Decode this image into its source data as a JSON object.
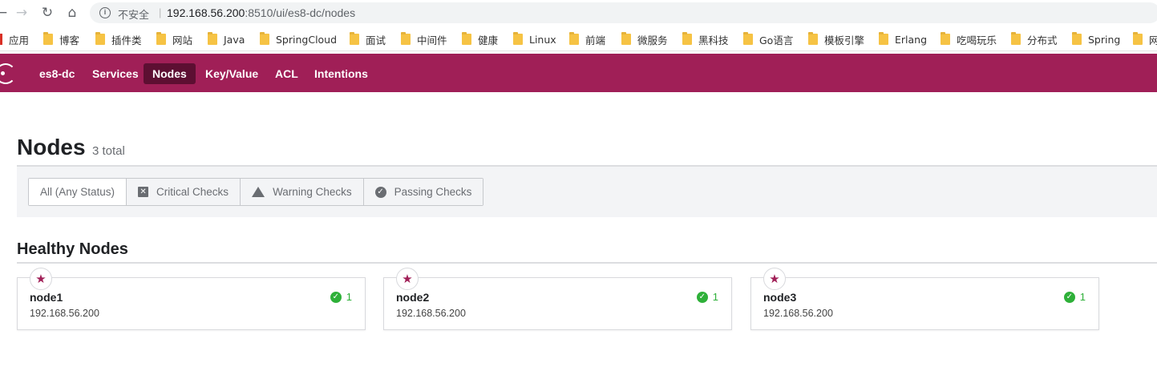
{
  "browser": {
    "insecure_label": "不安全",
    "url_host": "192.168.56.200",
    "url_rest": ":8510/ui/es8-dc/nodes",
    "separator": "|"
  },
  "bookmarks": [
    {
      "label": "应用",
      "icon": "apps-icon"
    },
    {
      "label": "博客",
      "icon": "folder-icon"
    },
    {
      "label": "插件类",
      "icon": "folder-icon"
    },
    {
      "label": "网站",
      "icon": "folder-icon"
    },
    {
      "label": "Java",
      "icon": "folder-icon"
    },
    {
      "label": "SpringCloud",
      "icon": "folder-icon"
    },
    {
      "label": "面试",
      "icon": "folder-icon"
    },
    {
      "label": "中间件",
      "icon": "folder-icon"
    },
    {
      "label": "健康",
      "icon": "folder-icon"
    },
    {
      "label": "Linux",
      "icon": "folder-icon"
    },
    {
      "label": "前端",
      "icon": "folder-icon"
    },
    {
      "label": "微服务",
      "icon": "folder-icon"
    },
    {
      "label": "黑科技",
      "icon": "folder-icon"
    },
    {
      "label": "Go语言",
      "icon": "folder-icon"
    },
    {
      "label": "模板引擎",
      "icon": "folder-icon"
    },
    {
      "label": "Erlang",
      "icon": "folder-icon"
    },
    {
      "label": "吃喝玩乐",
      "icon": "folder-icon"
    },
    {
      "label": "分布式",
      "icon": "folder-icon"
    },
    {
      "label": "Spring",
      "icon": "folder-icon"
    },
    {
      "label": "网",
      "icon": "folder-icon"
    }
  ],
  "header": {
    "brand_color": "#a01f57",
    "datacenter": "es8-dc",
    "nav": [
      {
        "label": "Services",
        "active": false
      },
      {
        "label": "Nodes",
        "active": true
      },
      {
        "label": "Key/Value",
        "active": false
      },
      {
        "label": "ACL",
        "active": false
      },
      {
        "label": "Intentions",
        "active": false
      }
    ]
  },
  "page": {
    "title": "Nodes",
    "total": "3 total"
  },
  "filters": {
    "all": "All (Any Status)",
    "critical": "Critical Checks",
    "warning": "Warning Checks",
    "passing": "Passing Checks"
  },
  "section": {
    "title": "Healthy Nodes"
  },
  "nodes": [
    {
      "name": "node1",
      "address": "192.168.56.200",
      "passing": "1",
      "leader_icon": "star-icon"
    },
    {
      "name": "node2",
      "address": "192.168.56.200",
      "passing": "1",
      "leader_icon": "star-icon"
    },
    {
      "name": "node3",
      "address": "192.168.56.200",
      "passing": "1",
      "leader_icon": "star-icon"
    }
  ]
}
